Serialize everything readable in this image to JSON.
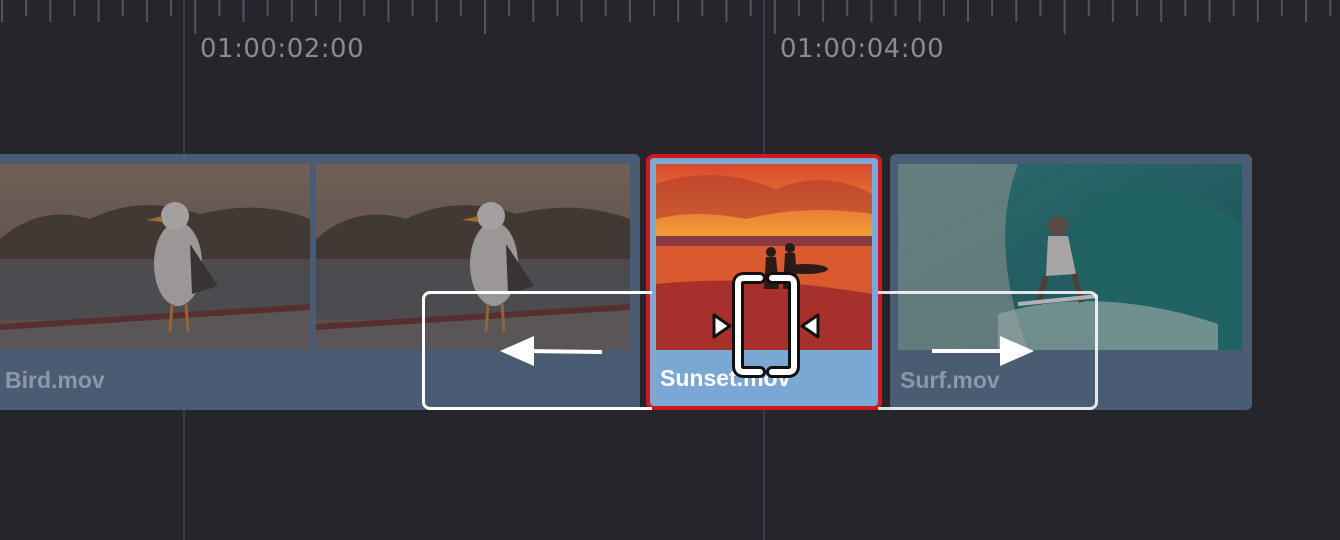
{
  "timeline": {
    "timecodes": [
      "01:00:02:00",
      "01:00:04:00"
    ]
  },
  "clips": [
    {
      "name": "Bird.mov"
    },
    {
      "name": "Sunset.mov"
    },
    {
      "name": "Surf.mov"
    }
  ],
  "colors": {
    "background": "#26252c",
    "clip_fill": "#4a5c74",
    "selected_clip_fill": "#7aa7d4",
    "selection_border": "#d0191d",
    "trim_outline": "#ffffff"
  },
  "icons": {
    "trim_cursor": "slip-trim-cursor-icon",
    "arrow_left": "arrow-left-icon",
    "arrow_right": "arrow-right-icon"
  }
}
